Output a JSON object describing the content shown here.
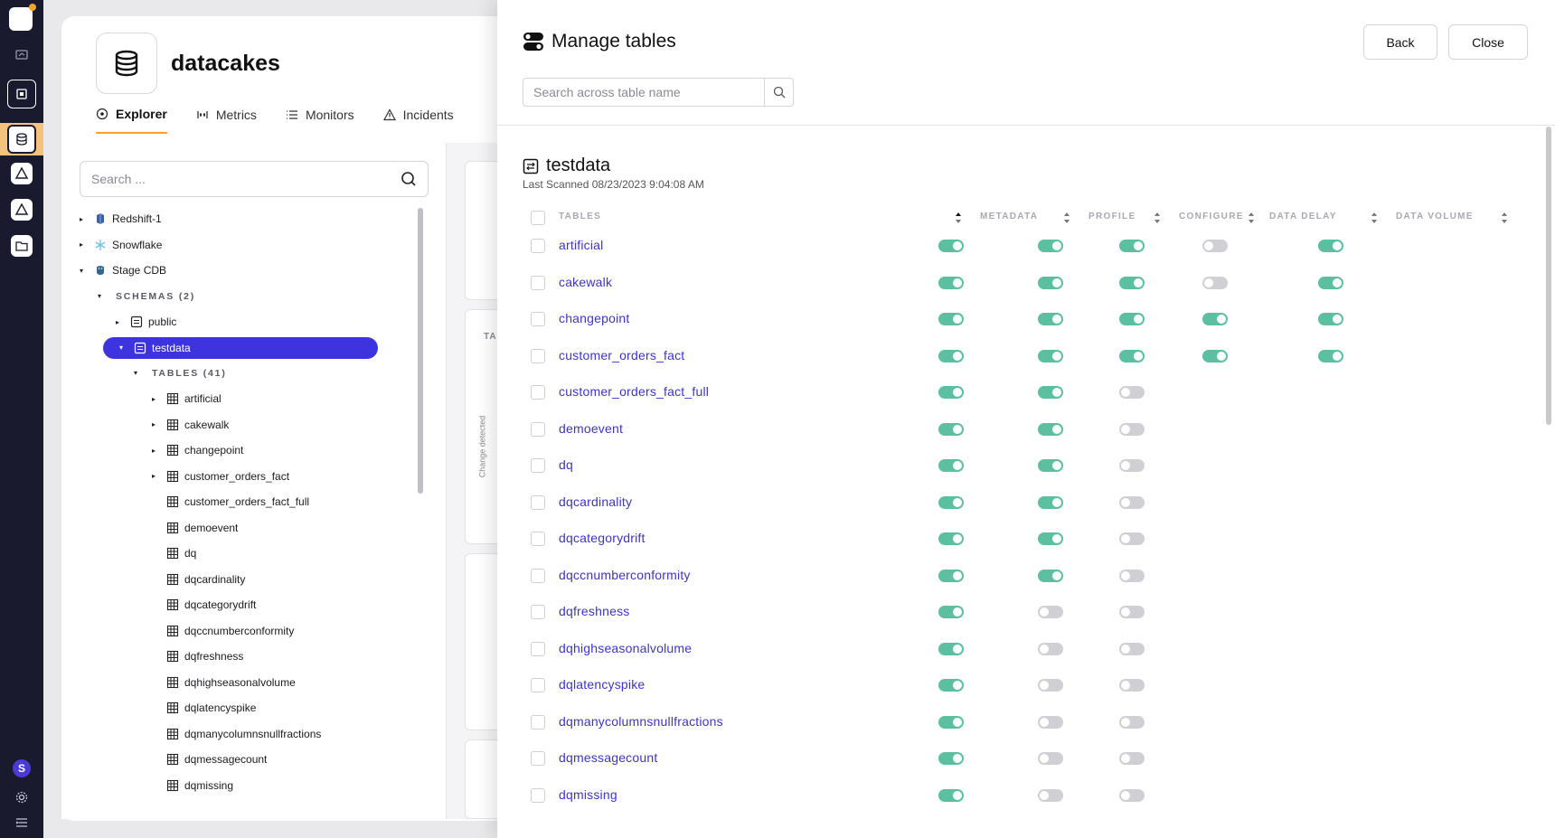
{
  "datasource": {
    "name": "datacakes"
  },
  "tabs": [
    {
      "label": "Explorer",
      "icon": "explorer-icon",
      "active": true
    },
    {
      "label": "Metrics",
      "icon": "metrics-icon",
      "active": false
    },
    {
      "label": "Monitors",
      "icon": "monitors-icon",
      "active": false
    },
    {
      "label": "Incidents",
      "icon": "incidents-icon",
      "active": false
    }
  ],
  "tree": {
    "search_placeholder": "Search ...",
    "items": [
      {
        "label": "Redshift-1",
        "level": 0,
        "caret": "▸",
        "icon": "redshift-icon"
      },
      {
        "label": "Snowflake",
        "level": 0,
        "caret": "▸",
        "icon": "snowflake-icon"
      },
      {
        "label": "Stage CDB",
        "level": 0,
        "caret": "▾",
        "icon": "postgres-icon"
      },
      {
        "label": "SCHEMAS (2)",
        "level": 1,
        "caret": "▾",
        "section": true
      },
      {
        "label": "public",
        "level": 2,
        "caret": "▸",
        "icon": "schema-icon"
      },
      {
        "label": "testdata",
        "level": 2,
        "caret": "▾",
        "icon": "schema-icon",
        "selected": true
      },
      {
        "label": "TABLES (41)",
        "level": 3,
        "caret": "▾",
        "section": true
      },
      {
        "label": "artificial",
        "level": 4,
        "caret": "▸",
        "icon": "table-icon"
      },
      {
        "label": "cakewalk",
        "level": 4,
        "caret": "▸",
        "icon": "table-icon"
      },
      {
        "label": "changepoint",
        "level": 4,
        "caret": "▸",
        "icon": "table-icon"
      },
      {
        "label": "customer_orders_fact",
        "level": 4,
        "caret": "▸",
        "icon": "table-icon"
      },
      {
        "label": "customer_orders_fact_full",
        "level": 4,
        "caret": "",
        "icon": "table-icon"
      },
      {
        "label": "demoevent",
        "level": 4,
        "caret": "",
        "icon": "table-icon"
      },
      {
        "label": "dq",
        "level": 4,
        "caret": "",
        "icon": "table-icon"
      },
      {
        "label": "dqcardinality",
        "level": 4,
        "caret": "",
        "icon": "table-icon"
      },
      {
        "label": "dqcategorydrift",
        "level": 4,
        "caret": "",
        "icon": "table-icon"
      },
      {
        "label": "dqccnumberconformity",
        "level": 4,
        "caret": "",
        "icon": "table-icon"
      },
      {
        "label": "dqfreshness",
        "level": 4,
        "caret": "",
        "icon": "table-icon"
      },
      {
        "label": "dqhighseasonalvolume",
        "level": 4,
        "caret": "",
        "icon": "table-icon"
      },
      {
        "label": "dqlatencyspike",
        "level": 4,
        "caret": "",
        "icon": "table-icon"
      },
      {
        "label": "dqmanycolumnsnullfractions",
        "level": 4,
        "caret": "",
        "icon": "table-icon"
      },
      {
        "label": "dqmessagecount",
        "level": 4,
        "caret": "",
        "icon": "table-icon"
      },
      {
        "label": "dqmissing",
        "level": 4,
        "caret": "",
        "icon": "table-icon"
      }
    ]
  },
  "background": {
    "cut_label_ta": "TA",
    "change_detected": "Change detected"
  },
  "modal": {
    "title": "Manage tables",
    "back_label": "Back",
    "close_label": "Close",
    "search_placeholder": "Search across table name",
    "schema_name": "testdata",
    "last_scanned": "Last Scanned 08/23/2023 9:04:08 AM",
    "columns": [
      "TABLES",
      "METADATA",
      "PROFILE",
      "CONFIGURE",
      "DATA DELAY",
      "DATA VOLUME"
    ],
    "rows": [
      {
        "name": "artificial",
        "metadata": true,
        "profile": true,
        "configure": true,
        "data_delay": false,
        "data_volume": true
      },
      {
        "name": "cakewalk",
        "metadata": true,
        "profile": true,
        "configure": true,
        "data_delay": false,
        "data_volume": true
      },
      {
        "name": "changepoint",
        "metadata": true,
        "profile": true,
        "configure": true,
        "data_delay": true,
        "data_volume": true
      },
      {
        "name": "customer_orders_fact",
        "metadata": true,
        "profile": true,
        "configure": true,
        "data_delay": true,
        "data_volume": true
      },
      {
        "name": "customer_orders_fact_full",
        "metadata": true,
        "profile": true,
        "configure": false,
        "data_delay": null,
        "data_volume": null
      },
      {
        "name": "demoevent",
        "metadata": true,
        "profile": true,
        "configure": false,
        "data_delay": null,
        "data_volume": null
      },
      {
        "name": "dq",
        "metadata": true,
        "profile": true,
        "configure": false,
        "data_delay": null,
        "data_volume": null
      },
      {
        "name": "dqcardinality",
        "metadata": true,
        "profile": true,
        "configure": false,
        "data_delay": null,
        "data_volume": null
      },
      {
        "name": "dqcategorydrift",
        "metadata": true,
        "profile": true,
        "configure": false,
        "data_delay": null,
        "data_volume": null
      },
      {
        "name": "dqccnumberconformity",
        "metadata": true,
        "profile": true,
        "configure": false,
        "data_delay": null,
        "data_volume": null
      },
      {
        "name": "dqfreshness",
        "metadata": true,
        "profile": false,
        "configure": false,
        "data_delay": null,
        "data_volume": null
      },
      {
        "name": "dqhighseasonalvolume",
        "metadata": true,
        "profile": false,
        "configure": false,
        "data_delay": null,
        "data_volume": null
      },
      {
        "name": "dqlatencyspike",
        "metadata": true,
        "profile": false,
        "configure": false,
        "data_delay": null,
        "data_volume": null
      },
      {
        "name": "dqmanycolumnsnullfractions",
        "metadata": true,
        "profile": false,
        "configure": false,
        "data_delay": null,
        "data_volume": null
      },
      {
        "name": "dqmessagecount",
        "metadata": true,
        "profile": false,
        "configure": false,
        "data_delay": null,
        "data_volume": null
      },
      {
        "name": "dqmissing",
        "metadata": true,
        "profile": false,
        "configure": false,
        "data_delay": null,
        "data_volume": null
      }
    ]
  },
  "rail": {
    "user_initial": "S"
  },
  "colors": {
    "accent": "#3d34e0",
    "toggle_on": "#5cbfa0",
    "toggle_off": "#cfcfd4",
    "link": "#3d34c8",
    "tab_underline": "#f5a524"
  }
}
